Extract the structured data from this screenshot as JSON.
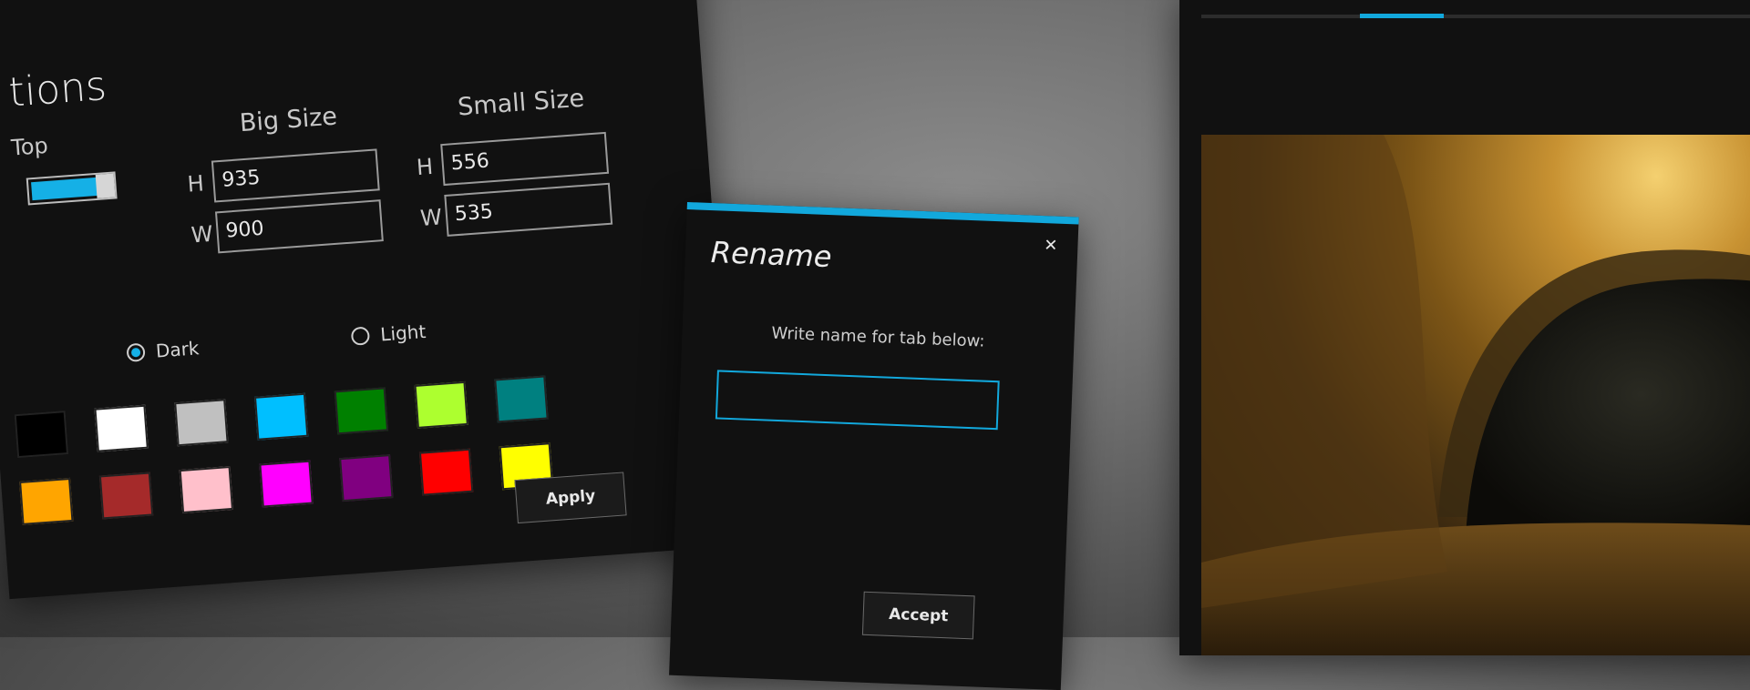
{
  "options": {
    "title": "tions",
    "top_label": "Top",
    "big_size": {
      "header": "Big Size",
      "h_label": "H",
      "w_label": "W",
      "h_value": "935",
      "w_value": "900"
    },
    "small_size": {
      "header": "Small Size",
      "h_label": "H",
      "w_label": "W",
      "h_value": "556",
      "w_value": "535"
    },
    "theme": {
      "dark_label": "Dark",
      "light_label": "Light",
      "selected": "Dark"
    },
    "swatch_colors": [
      [
        "#000000",
        "#ffffff",
        "#c0c0c0",
        "#00bfff",
        "#008000",
        "#adff2f",
        "#008080"
      ],
      [
        "#ffa500",
        "#a52a2a",
        "#ffc0cb",
        "#ff00ff",
        "#800080",
        "#ff0000",
        "#ffff00"
      ]
    ],
    "apply_label": "Apply",
    "close_glyph": "✕"
  },
  "rename": {
    "title": "Rename",
    "prompt": "Write name for tab below:",
    "input_value": "",
    "accept_label": "Accept",
    "close_glyph": "✕"
  },
  "viewer": {
    "image_subject": "tunnel-photo"
  },
  "colors": {
    "accent": "#12a8dc",
    "panel_bg": "#111111"
  }
}
